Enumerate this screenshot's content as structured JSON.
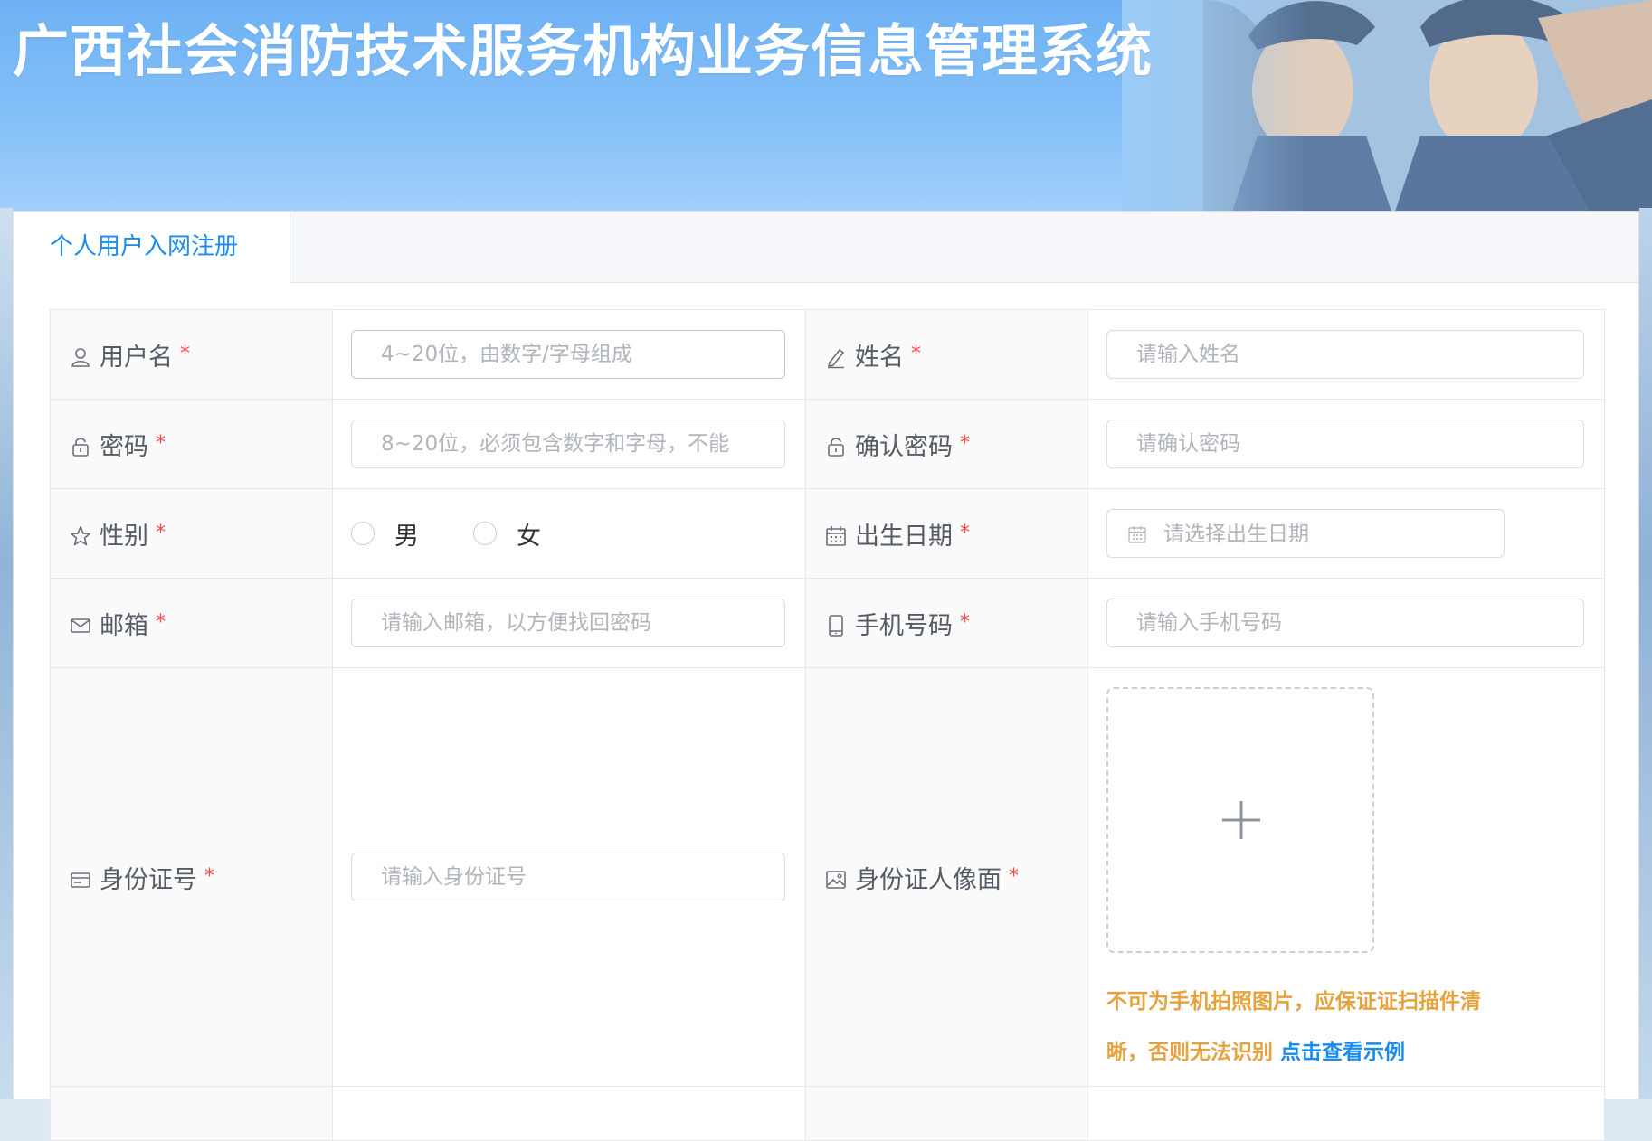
{
  "header": {
    "title": "广西社会消防技术服务机构业务信息管理系统"
  },
  "tabs": [
    {
      "label": "个人用户入网注册"
    }
  ],
  "form": {
    "required_mark": "*",
    "username": {
      "label": "用户名",
      "placeholder": "4~20位，由数字/字母组成"
    },
    "name": {
      "label": "姓名",
      "placeholder": "请输入姓名"
    },
    "password": {
      "label": "密码",
      "placeholder": "8~20位，必须包含数字和字母，不能"
    },
    "confirm_password": {
      "label": "确认密码",
      "placeholder": "请确认密码"
    },
    "gender": {
      "label": "性别",
      "options": [
        "男",
        "女"
      ]
    },
    "birthdate": {
      "label": "出生日期",
      "placeholder": "请选择出生日期"
    },
    "email": {
      "label": "邮箱",
      "placeholder": "请输入邮箱，以方便找回密码"
    },
    "phone": {
      "label": "手机号码",
      "placeholder": "请输入手机号码"
    },
    "id_number": {
      "label": "身份证号",
      "placeholder": "请输入身份证号"
    },
    "id_photo": {
      "label": "身份证人像面",
      "upload_symbol": "+",
      "hint": "不可为手机拍照图片，应保证证扫描件清晰，否则无法识别",
      "example_link": "点击查看示例"
    }
  },
  "colors": {
    "accent": "#1a8cf0",
    "required": "#f04848",
    "warning": "#e6a23c",
    "banner": "#7ab8f6"
  },
  "icons": {
    "username": "user-icon",
    "name": "pen-icon",
    "password": "lock-icon",
    "confirm_password": "lock-icon",
    "gender": "star-icon",
    "birthdate": "calendar-icon",
    "email": "mail-icon",
    "phone": "phone-icon",
    "id_number": "id-card-icon",
    "id_photo": "image-icon"
  }
}
